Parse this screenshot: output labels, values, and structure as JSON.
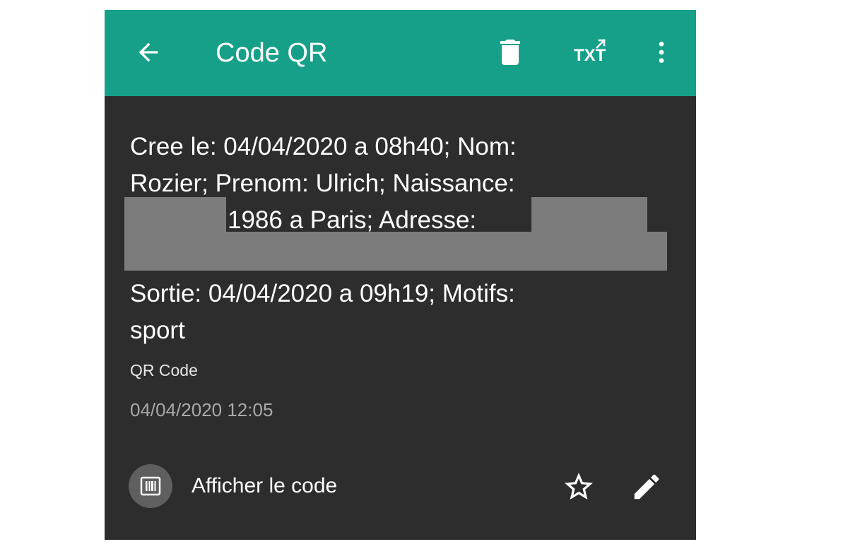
{
  "appbar": {
    "title": "Code QR",
    "icons": {
      "back": "arrow-left-icon",
      "delete": "trash-icon",
      "export_txt": "txt-export-icon",
      "more": "more-vertical-icon"
    },
    "export_txt_label": "TXT",
    "color": "#16a08a"
  },
  "content": {
    "lines": [
      "Cree le: 04/04/2020 a 08h40; Nom:",
      "Rozier; Prenom: Ulrich; Naissance:",
      "1986 a Paris; Adresse:",
      "Sortie: 04/04/2020 a 09h19; Motifs:",
      "sport"
    ]
  },
  "meta": {
    "type": "QR Code",
    "date": "04/04/2020 12:05"
  },
  "actions": {
    "show_code_label": "Afficher le code",
    "icons": {
      "barcode": "barcode-icon",
      "favorite": "star-outline-icon",
      "edit": "pencil-icon"
    }
  },
  "colors": {
    "background": "#2d2d2d",
    "redaction": "#7c7c7c"
  }
}
